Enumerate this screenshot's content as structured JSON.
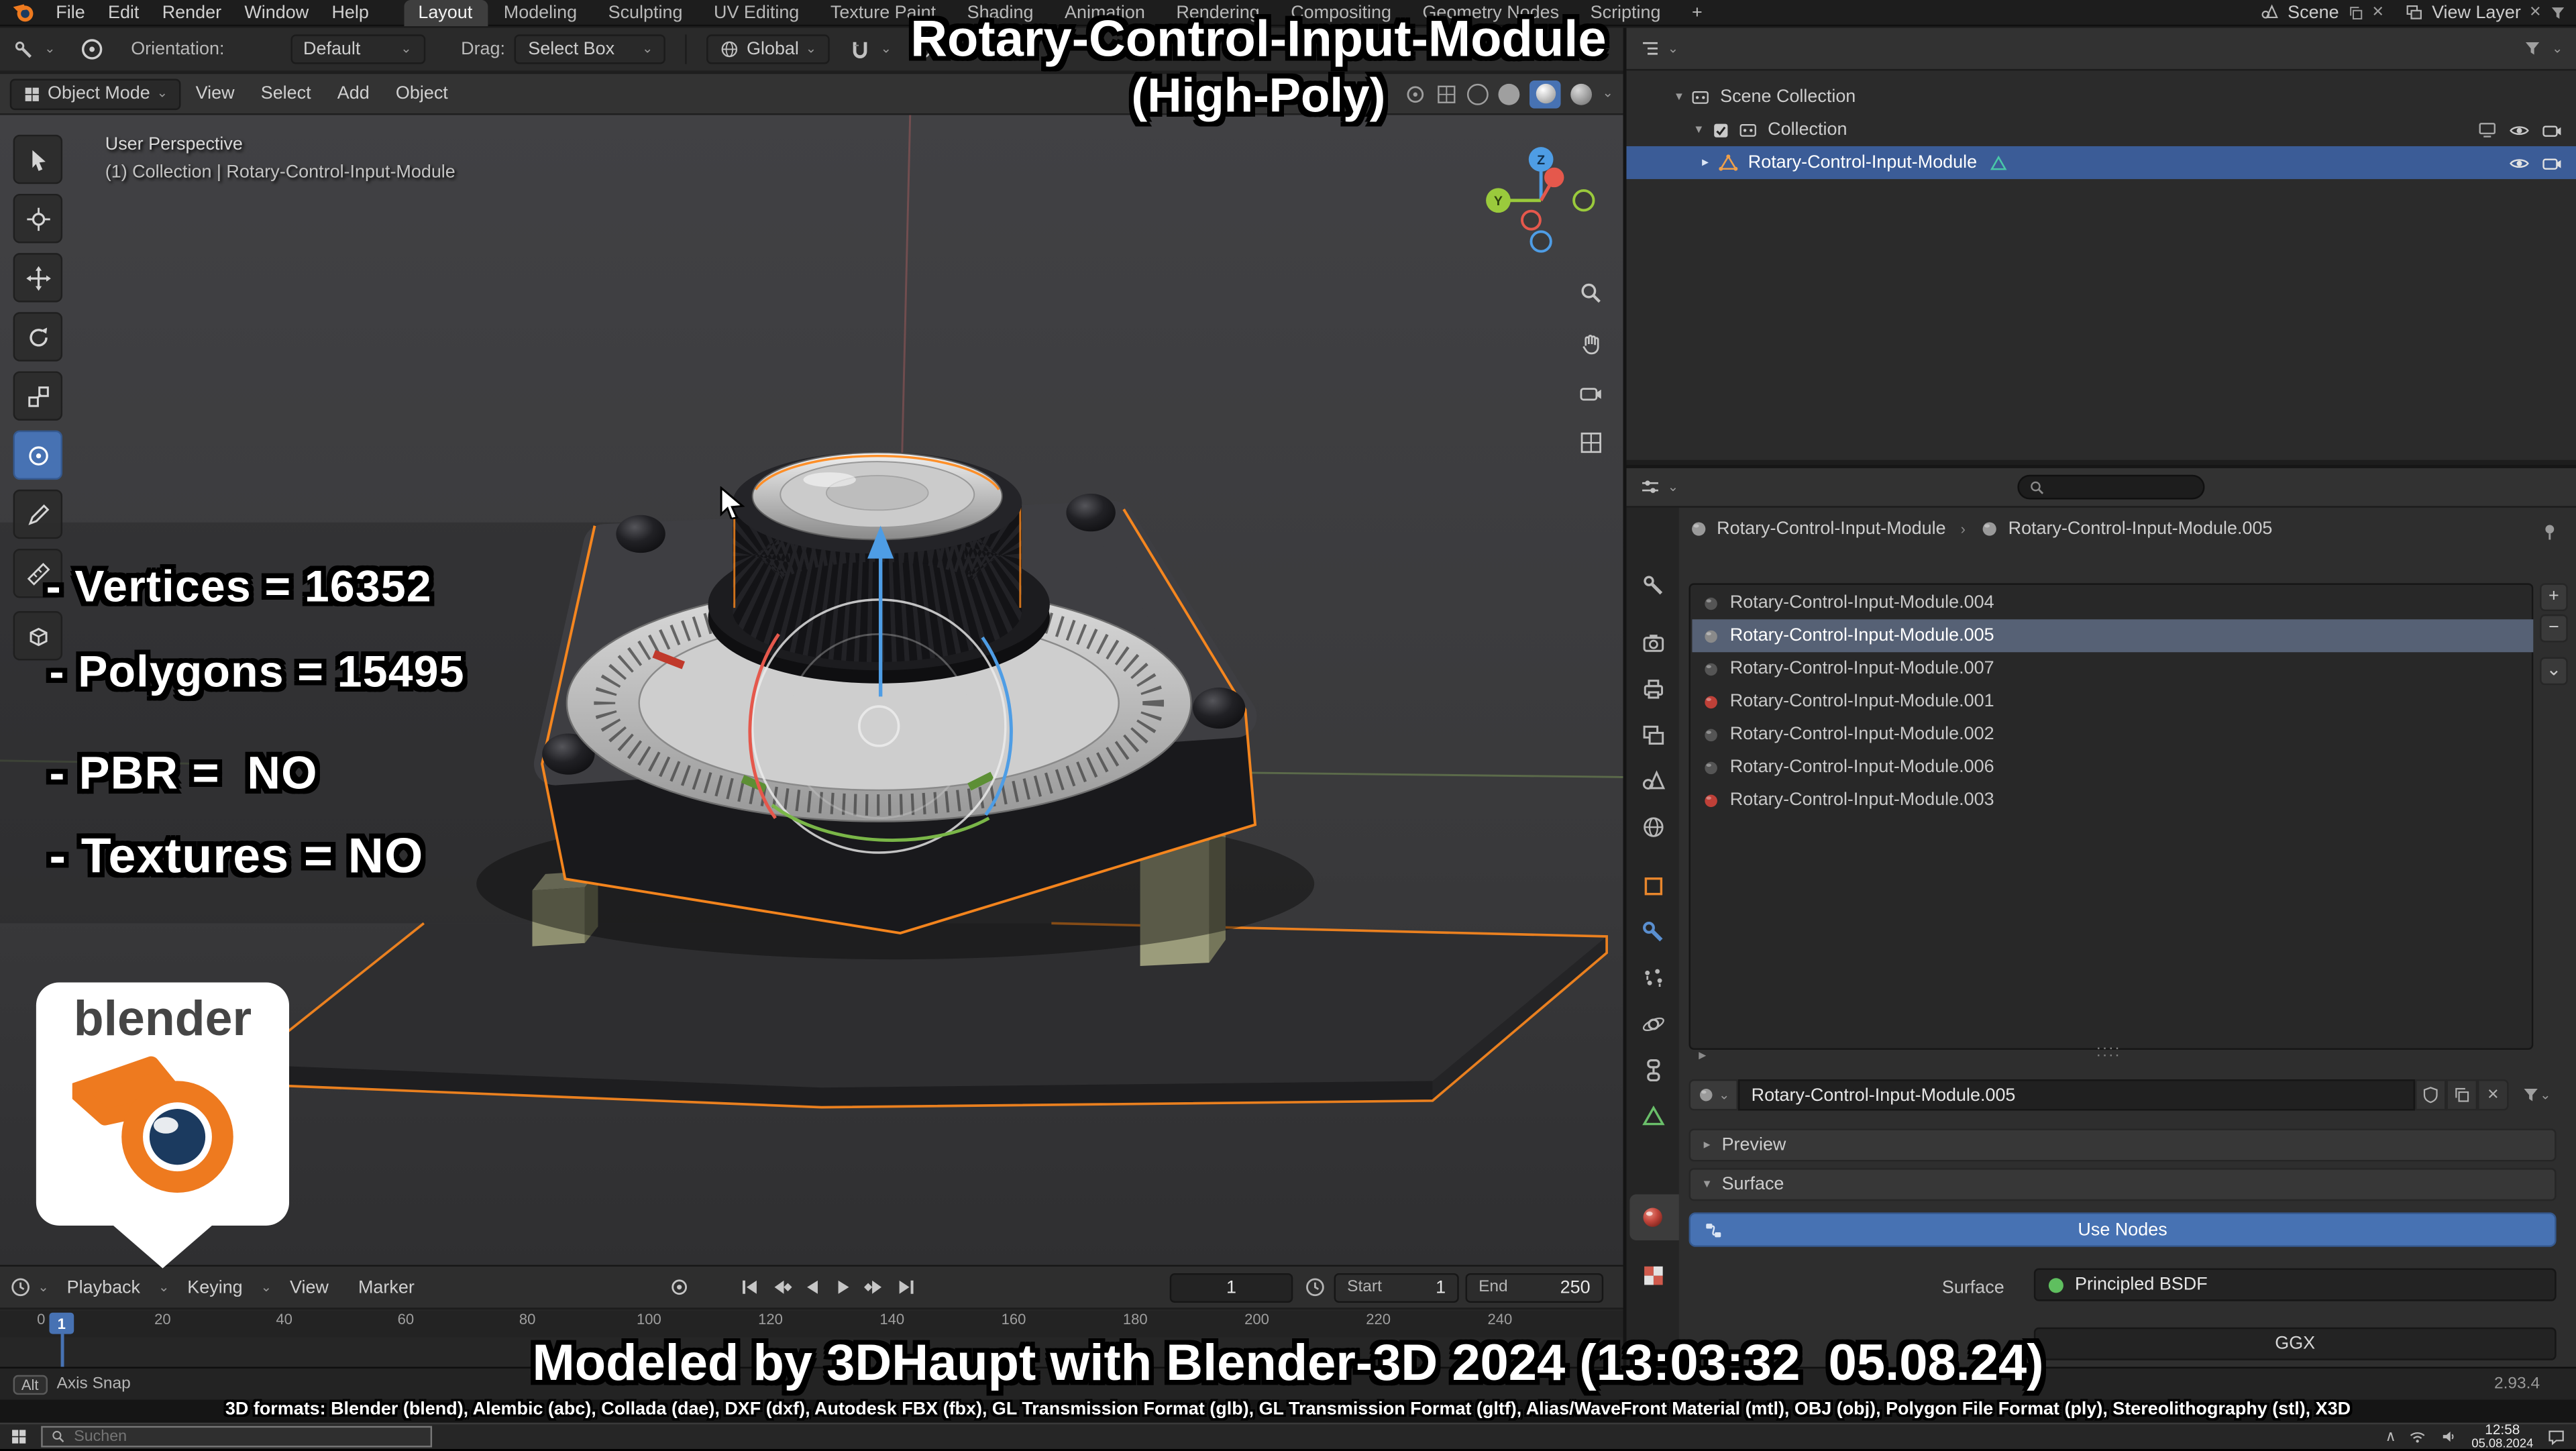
{
  "colors": {
    "accent_blue": "#4772b3",
    "selection_orange": "#ff8a1e",
    "axis_x": "#e5584c",
    "axis_y": "#9aca3c",
    "axis_z": "#4e9de5"
  },
  "topbar": {
    "menus": [
      "File",
      "Edit",
      "Render",
      "Window",
      "Help"
    ],
    "workspaces": [
      "Layout",
      "Modeling",
      "Sculpting",
      "UV Editing",
      "Texture Paint",
      "Shading",
      "Animation",
      "Rendering",
      "Compositing",
      "Geometry Nodes",
      "Scripting"
    ],
    "add_workspace": "+",
    "scene": "Scene",
    "view_layer": "View Layer"
  },
  "tool_settings": {
    "orientation_label": "Orientation:",
    "orientation_value": "Default",
    "drag_label": "Drag:",
    "drag_value": "Select Box",
    "transform_space": "Global"
  },
  "viewport_header": {
    "mode": "Object Mode",
    "menus": [
      "View",
      "Select",
      "Add",
      "Object"
    ]
  },
  "viewport": {
    "view_label": "User Perspective",
    "context_label": "(1) Collection | Rotary-Control-Input-Module",
    "axis_labels": {
      "z": "Z",
      "y": "Y"
    },
    "overlay": {
      "title": "Rotary-Control-Input-Module",
      "subtitle": "(High-Poly)",
      "stats": [
        "- Vertices = 16352",
        "- Polygons = 15495",
        "- PBR =  NO",
        "- Textures = NO"
      ],
      "credit": "Modeled by 3DHaupt with Blender-3D 2024 (13:03:32  05.08.24)",
      "formats": "3D formats: Blender (blend), Alembic (abc), Collada (dae), DXF (dxf), Autodesk FBX (fbx), GL Transmission Format (glb), GL Transmission Format (gltf), Alias/WaveFront Material (mtl), OBJ (obj), Polygon File Format (ply), Stereolithography (stl), X3D",
      "logo_text": "blender"
    }
  },
  "timeline": {
    "menus": [
      "Playback",
      "Keying",
      "View",
      "Marker"
    ],
    "current_frame": "1",
    "start_label": "Start",
    "start_value": "1",
    "end_label": "End",
    "end_value": "250",
    "ruler": [
      "0",
      "20",
      "40",
      "60",
      "80",
      "100",
      "120",
      "140",
      "160",
      "180",
      "200",
      "220",
      "240"
    ],
    "playhead": "1"
  },
  "outliner": {
    "rows": [
      {
        "label": "Scene Collection"
      },
      {
        "label": "Collection"
      },
      {
        "label": "Rotary-Control-Input-Module"
      }
    ]
  },
  "properties": {
    "breadcrumb": [
      "Rotary-Control-Input-Module",
      "Rotary-Control-Input-Module.005"
    ],
    "slots": [
      "Rotary-Control-Input-Module.004",
      "Rotary-Control-Input-Module.005",
      "Rotary-Control-Input-Module.007",
      "Rotary-Control-Input-Module.001",
      "Rotary-Control-Input-Module.002",
      "Rotary-Control-Input-Module.006",
      "Rotary-Control-Input-Module.003"
    ],
    "material_name": "Rotary-Control-Input-Module.005",
    "preview_label": "Preview",
    "surface_label": "Surface",
    "use_nodes_label": "Use Nodes",
    "surface_prop_label": "Surface",
    "surface_prop_value": "Principled BSDF",
    "distribution_value": "GGX"
  },
  "statusbar": {
    "hint_key": "Alt",
    "hint_text": "Axis Snap",
    "version": "2.93.4"
  },
  "taskbar": {
    "search_placeholder": "Suchen",
    "time": "12:58",
    "date": "05.08.2024"
  },
  "icons": {
    "chevron_down": "⌄",
    "chevron_right": "▸",
    "chevron_expanded": "▾",
    "breadcrumb_sep": "›",
    "plus": "+",
    "minus": "−",
    "close": "✕",
    "drag_dots": "::::",
    "caret_up": "∧"
  }
}
